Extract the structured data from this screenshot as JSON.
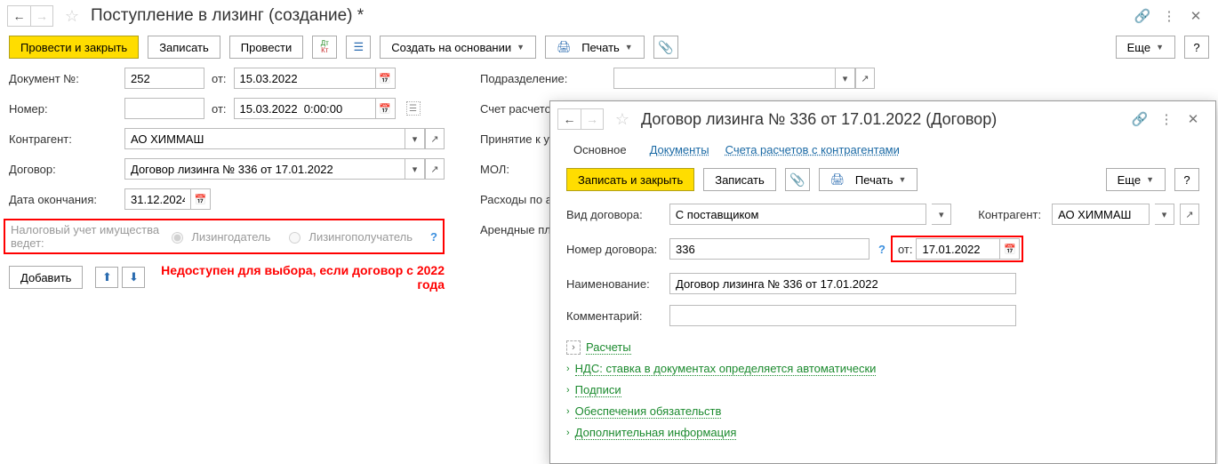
{
  "main": {
    "title": "Поступление в лизинг (создание) *",
    "toolbar": {
      "post_close": "Провести и закрыть",
      "save": "Записать",
      "post": "Провести",
      "create_based": "Создать на основании",
      "print": "Печать",
      "more": "Еще",
      "help": "?"
    },
    "labels": {
      "doc_num": "Документ №:",
      "from": "от:",
      "number": "Номер:",
      "counterparty": "Контрагент:",
      "contract": "Договор:",
      "end_date": "Дата окончания:",
      "tax_label": "Налоговый учет имущества ведет:",
      "radio1": "Лизингодатель",
      "radio2": "Лизингополучатель",
      "department": "Подразделение:",
      "settlement_acc": "Счет расчетов:",
      "accept": "Принятие к учету",
      "mol": "МОЛ:",
      "amort_expense": "Расходы по амо",
      "lease_pay": "Арендные платеж",
      "add": "Добавить"
    },
    "values": {
      "doc_num": "252",
      "doc_date": "15.03.2022",
      "num_date": "15.03.2022  0:00:00",
      "counterparty": "АО ХИММАШ",
      "contract": "Договор лизинга № 336 от 17.01.2022",
      "end_date": "31.12.2024"
    },
    "note": "Недоступен для выбора, если договор с 2022 года"
  },
  "popup": {
    "title": "Договор лизинга № 336 от 17.01.2022 (Договор)",
    "tabs": {
      "main": "Основное",
      "docs": "Документы",
      "accounts": "Счета расчетов с контрагентами"
    },
    "toolbar": {
      "save_close": "Записать и закрыть",
      "save": "Записать",
      "print": "Печать",
      "more": "Еще",
      "help": "?"
    },
    "labels": {
      "contract_type": "Вид договора:",
      "counterparty": "Контрагент:",
      "contract_no": "Номер договора:",
      "from": "от:",
      "name": "Наименование:",
      "comment": "Комментарий:"
    },
    "values": {
      "contract_type": "С поставщиком",
      "counterparty": "АО ХИММАШ",
      "contract_no": "336",
      "contract_date": "17.01.2022",
      "name": "Договор лизинга № 336 от 17.01.2022"
    },
    "expand": {
      "calc": "Расчеты",
      "vat": "НДС: ставка в документах определяется автоматически",
      "sign": "Подписи",
      "oblig": "Обеспечения обязательств",
      "more_info": "Дополнительная информация"
    }
  }
}
